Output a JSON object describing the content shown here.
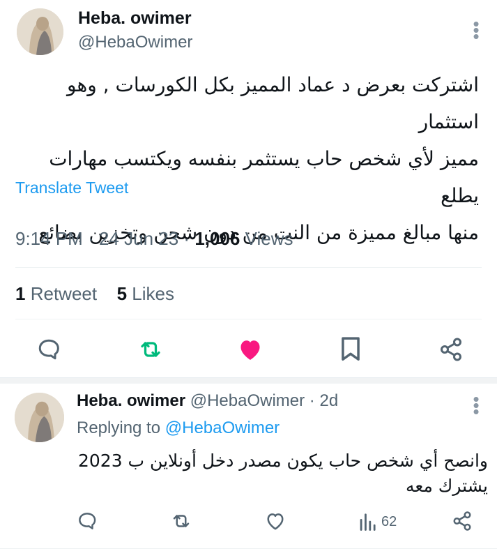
{
  "main_tweet": {
    "author_name": "Heba. owimer",
    "author_handle": "@HebaOwimer",
    "text_lines": [
      "اشتركت بعرض د عماد المميز بكل الكورسات , وهو استثمار",
      "مميز لأي شخص حاب يستثمر بنفسه ويكتسب مهارات يطلع",
      "منها مبالغ مميزة من النت من دون شحن وتخزين بضائع"
    ],
    "translate_label": "Translate Tweet",
    "time": "9:14 PM",
    "date": "24 Jun 23",
    "views_count": "1,006",
    "views_label": "Views",
    "retweets_count": "1",
    "retweets_label": "Retweet",
    "likes_count": "5",
    "likes_label": "Likes",
    "liked": true
  },
  "reply": {
    "author_name": "Heba. owimer",
    "author_handle": "@HebaOwimer",
    "age": "2d",
    "replying_prefix": "Replying to",
    "replying_handle": "@HebaOwimer",
    "text_lines": [
      "وانصح أي شخص حاب يكون مصدر دخل أونلاين ب 2023",
      "يشترك معه"
    ],
    "views_count": "62"
  },
  "icons": {
    "reply": "comment-icon",
    "retweet": "retweet-icon",
    "like": "heart-icon",
    "bookmark": "bookmark-icon",
    "share": "share-icon",
    "views": "analytics-icon",
    "more": "more-vertical-icon"
  },
  "colors": {
    "accent": "#1d9bf0",
    "retweet": "#00ba7c",
    "like": "#f91880",
    "muted": "#536471"
  }
}
